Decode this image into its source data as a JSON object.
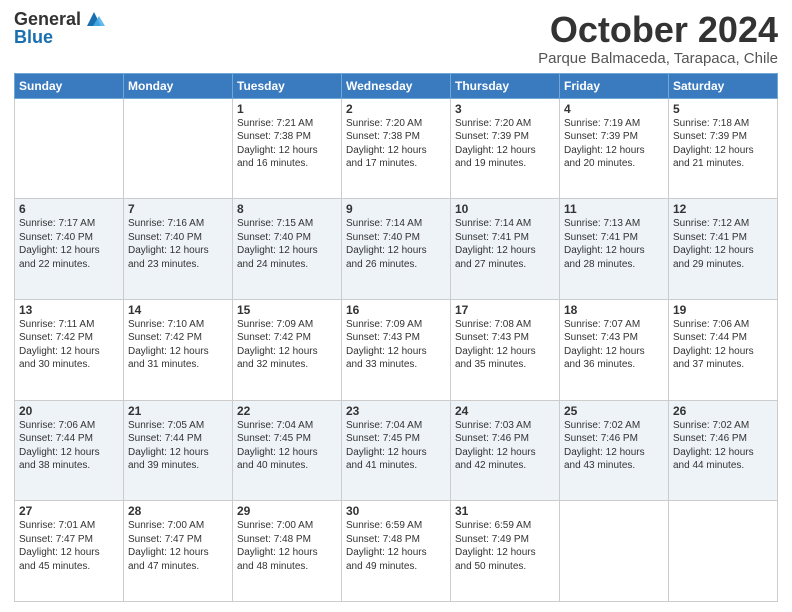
{
  "header": {
    "logo_general": "General",
    "logo_blue": "Blue",
    "title": "October 2024",
    "location": "Parque Balmaceda, Tarapaca, Chile"
  },
  "days_of_week": [
    "Sunday",
    "Monday",
    "Tuesday",
    "Wednesday",
    "Thursday",
    "Friday",
    "Saturday"
  ],
  "weeks": [
    [
      {
        "day": "",
        "text": ""
      },
      {
        "day": "",
        "text": ""
      },
      {
        "day": "1",
        "text": "Sunrise: 7:21 AM\nSunset: 7:38 PM\nDaylight: 12 hours\nand 16 minutes."
      },
      {
        "day": "2",
        "text": "Sunrise: 7:20 AM\nSunset: 7:38 PM\nDaylight: 12 hours\nand 17 minutes."
      },
      {
        "day": "3",
        "text": "Sunrise: 7:20 AM\nSunset: 7:39 PM\nDaylight: 12 hours\nand 19 minutes."
      },
      {
        "day": "4",
        "text": "Sunrise: 7:19 AM\nSunset: 7:39 PM\nDaylight: 12 hours\nand 20 minutes."
      },
      {
        "day": "5",
        "text": "Sunrise: 7:18 AM\nSunset: 7:39 PM\nDaylight: 12 hours\nand 21 minutes."
      }
    ],
    [
      {
        "day": "6",
        "text": "Sunrise: 7:17 AM\nSunset: 7:40 PM\nDaylight: 12 hours\nand 22 minutes."
      },
      {
        "day": "7",
        "text": "Sunrise: 7:16 AM\nSunset: 7:40 PM\nDaylight: 12 hours\nand 23 minutes."
      },
      {
        "day": "8",
        "text": "Sunrise: 7:15 AM\nSunset: 7:40 PM\nDaylight: 12 hours\nand 24 minutes."
      },
      {
        "day": "9",
        "text": "Sunrise: 7:14 AM\nSunset: 7:40 PM\nDaylight: 12 hours\nand 26 minutes."
      },
      {
        "day": "10",
        "text": "Sunrise: 7:14 AM\nSunset: 7:41 PM\nDaylight: 12 hours\nand 27 minutes."
      },
      {
        "day": "11",
        "text": "Sunrise: 7:13 AM\nSunset: 7:41 PM\nDaylight: 12 hours\nand 28 minutes."
      },
      {
        "day": "12",
        "text": "Sunrise: 7:12 AM\nSunset: 7:41 PM\nDaylight: 12 hours\nand 29 minutes."
      }
    ],
    [
      {
        "day": "13",
        "text": "Sunrise: 7:11 AM\nSunset: 7:42 PM\nDaylight: 12 hours\nand 30 minutes."
      },
      {
        "day": "14",
        "text": "Sunrise: 7:10 AM\nSunset: 7:42 PM\nDaylight: 12 hours\nand 31 minutes."
      },
      {
        "day": "15",
        "text": "Sunrise: 7:09 AM\nSunset: 7:42 PM\nDaylight: 12 hours\nand 32 minutes."
      },
      {
        "day": "16",
        "text": "Sunrise: 7:09 AM\nSunset: 7:43 PM\nDaylight: 12 hours\nand 33 minutes."
      },
      {
        "day": "17",
        "text": "Sunrise: 7:08 AM\nSunset: 7:43 PM\nDaylight: 12 hours\nand 35 minutes."
      },
      {
        "day": "18",
        "text": "Sunrise: 7:07 AM\nSunset: 7:43 PM\nDaylight: 12 hours\nand 36 minutes."
      },
      {
        "day": "19",
        "text": "Sunrise: 7:06 AM\nSunset: 7:44 PM\nDaylight: 12 hours\nand 37 minutes."
      }
    ],
    [
      {
        "day": "20",
        "text": "Sunrise: 7:06 AM\nSunset: 7:44 PM\nDaylight: 12 hours\nand 38 minutes."
      },
      {
        "day": "21",
        "text": "Sunrise: 7:05 AM\nSunset: 7:44 PM\nDaylight: 12 hours\nand 39 minutes."
      },
      {
        "day": "22",
        "text": "Sunrise: 7:04 AM\nSunset: 7:45 PM\nDaylight: 12 hours\nand 40 minutes."
      },
      {
        "day": "23",
        "text": "Sunrise: 7:04 AM\nSunset: 7:45 PM\nDaylight: 12 hours\nand 41 minutes."
      },
      {
        "day": "24",
        "text": "Sunrise: 7:03 AM\nSunset: 7:46 PM\nDaylight: 12 hours\nand 42 minutes."
      },
      {
        "day": "25",
        "text": "Sunrise: 7:02 AM\nSunset: 7:46 PM\nDaylight: 12 hours\nand 43 minutes."
      },
      {
        "day": "26",
        "text": "Sunrise: 7:02 AM\nSunset: 7:46 PM\nDaylight: 12 hours\nand 44 minutes."
      }
    ],
    [
      {
        "day": "27",
        "text": "Sunrise: 7:01 AM\nSunset: 7:47 PM\nDaylight: 12 hours\nand 45 minutes."
      },
      {
        "day": "28",
        "text": "Sunrise: 7:00 AM\nSunset: 7:47 PM\nDaylight: 12 hours\nand 47 minutes."
      },
      {
        "day": "29",
        "text": "Sunrise: 7:00 AM\nSunset: 7:48 PM\nDaylight: 12 hours\nand 48 minutes."
      },
      {
        "day": "30",
        "text": "Sunrise: 6:59 AM\nSunset: 7:48 PM\nDaylight: 12 hours\nand 49 minutes."
      },
      {
        "day": "31",
        "text": "Sunrise: 6:59 AM\nSunset: 7:49 PM\nDaylight: 12 hours\nand 50 minutes."
      },
      {
        "day": "",
        "text": ""
      },
      {
        "day": "",
        "text": ""
      }
    ]
  ]
}
